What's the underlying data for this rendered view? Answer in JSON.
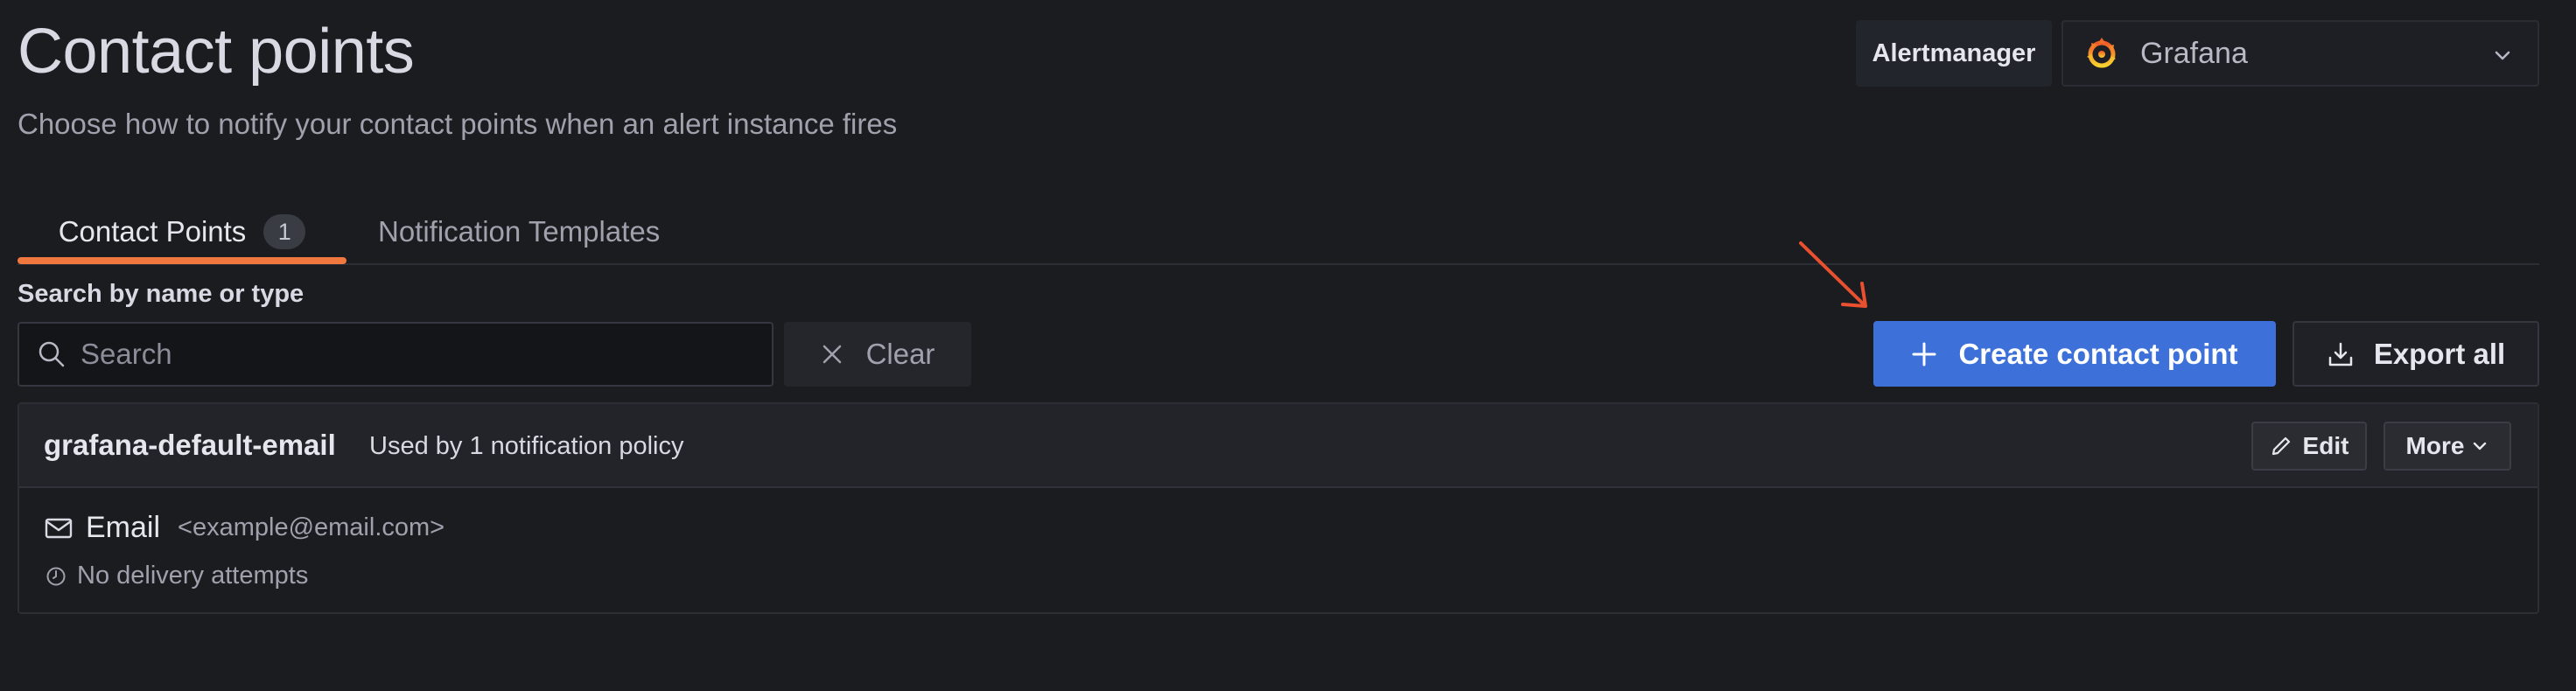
{
  "header": {
    "title": "Contact points",
    "subtitle": "Choose how to notify your contact points when an alert instance fires"
  },
  "alertmanager": {
    "label": "Alertmanager",
    "selected": "Grafana",
    "logo_icon": "grafana-logo-icon"
  },
  "tabs": [
    {
      "label": "Contact Points",
      "count": "1",
      "active": true
    },
    {
      "label": "Notification Templates",
      "active": false
    }
  ],
  "search": {
    "label": "Search by name or type",
    "placeholder": "Search",
    "value": ""
  },
  "actions": {
    "clear_label": "Clear",
    "create_label": "Create contact point",
    "export_label": "Export all"
  },
  "contact_points": [
    {
      "name": "grafana-default-email",
      "usage": "Used by 1 notification policy",
      "edit_label": "Edit",
      "more_label": "More",
      "integrations": [
        {
          "type": "Email",
          "address": "<example@email.com>",
          "delivery_status": "No delivery attempts"
        }
      ]
    }
  ],
  "colors": {
    "background": "#1b1c20",
    "primary_button": "#3d71d9",
    "active_tab_underline": "#f0783f",
    "annotation_arrow": "#e8502f"
  }
}
